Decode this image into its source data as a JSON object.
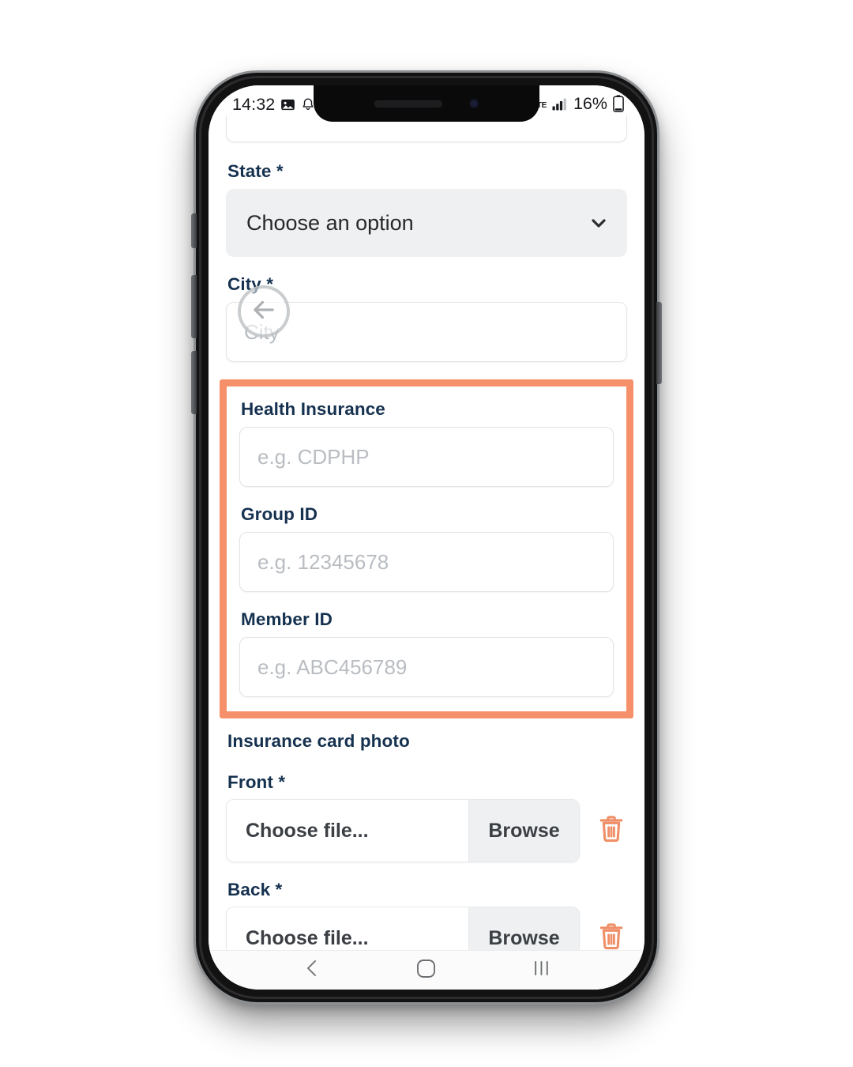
{
  "status_bar": {
    "time": "14:32",
    "battery_percent": "16%",
    "network_type": "LTE",
    "icons": [
      "image-icon",
      "notification-bell-icon",
      "signal-bars-icon",
      "battery-icon"
    ]
  },
  "form": {
    "state": {
      "label": "State *",
      "selected_option": "Choose an option"
    },
    "city": {
      "label": "City *",
      "placeholder": "City",
      "value": ""
    },
    "health_insurance": {
      "label": "Health Insurance",
      "placeholder": "e.g. CDPHP",
      "value": ""
    },
    "group_id": {
      "label": "Group ID",
      "placeholder": "e.g. 12345678",
      "value": ""
    },
    "member_id": {
      "label": "Member ID",
      "placeholder": "e.g. ABC456789",
      "value": ""
    },
    "insurance_card_photo": {
      "section_label": "Insurance card photo",
      "front": {
        "label": "Front *",
        "file_name": "Choose file...",
        "browse_label": "Browse",
        "delete_icon": "trash-icon"
      },
      "back": {
        "label": "Back *",
        "file_name": "Choose file...",
        "browse_label": "Browse",
        "delete_icon": "trash-icon"
      }
    }
  },
  "back_button": {
    "icon": "arrow-left-icon"
  },
  "nav_bar": {
    "back": "back-chevron-icon",
    "home": "home-circle-icon",
    "recents": "recents-icon"
  },
  "colors": {
    "highlight": "#f5906b",
    "label_navy": "#15314f",
    "trash_orange": "#ef8f68",
    "select_bg": "#eef0f1",
    "placeholder": "#b9bdc2"
  }
}
